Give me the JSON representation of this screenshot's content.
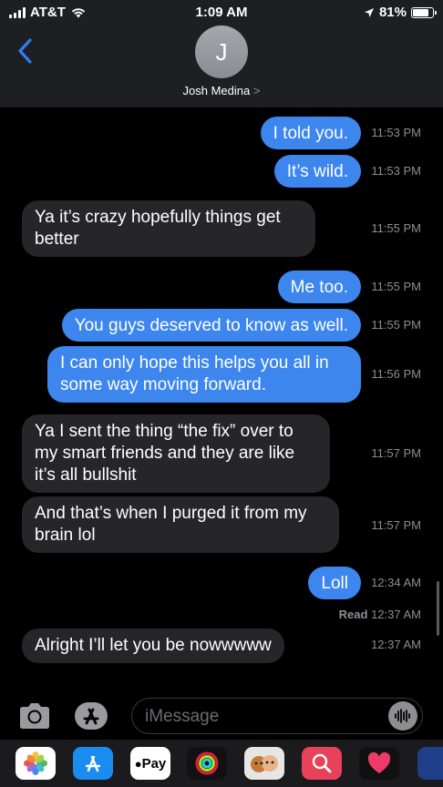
{
  "status_bar": {
    "carrier": "AT&T",
    "time": "1:09 AM",
    "battery": "81%"
  },
  "contact": {
    "initial": "J",
    "name": "Josh Medina",
    "chevron": ">"
  },
  "messages": [
    {
      "text": "I told you.",
      "time": "11:53 PM",
      "from": "me"
    },
    {
      "text": "It’s wild.",
      "time": "11:53 PM",
      "from": "me"
    },
    {
      "text": "Ya it’s crazy hopefully things get better",
      "time": "11:55 PM",
      "from": "them"
    },
    {
      "text": "Me too.",
      "time": "11:55 PM",
      "from": "me"
    },
    {
      "text": "You guys deserved to know as well.",
      "time": "11:55 PM",
      "from": "me"
    },
    {
      "text": "I can only hope this helps you all in some way moving forward.",
      "time": "11:56 PM",
      "from": "me"
    },
    {
      "text": "Ya I sent the thing “the fix” over to my smart friends and they are like it’s all bullshit",
      "time": "11:57 PM",
      "from": "them"
    },
    {
      "text": "And that’s when I purged it from my brain lol",
      "time": "11:57 PM",
      "from": "them"
    },
    {
      "text": "Loll",
      "time": "12:34 AM",
      "from": "me"
    },
    {
      "text": "Alright I’ll let you be nowwwww",
      "time": "12:37 AM",
      "from": "them"
    }
  ],
  "read_receipt": {
    "label": "Read",
    "time": "12:37 AM"
  },
  "compose": {
    "placeholder": "iMessage"
  },
  "apps": {
    "applepay_label": "Pay"
  },
  "colors": {
    "sent": "#3c86ee",
    "received": "#26262a",
    "accent": "#2f7cf6"
  },
  "icons": [
    "signal-icon",
    "wifi-icon",
    "location-icon",
    "battery-icon",
    "back-chevron-icon",
    "camera-icon",
    "appstore-icon",
    "audio-waveform-icon",
    "photos-app-icon",
    "appstore-app-icon",
    "applepay-app-icon",
    "activity-app-icon",
    "memoji-app-icon",
    "search-images-app-icon",
    "digital-touch-app-icon"
  ]
}
